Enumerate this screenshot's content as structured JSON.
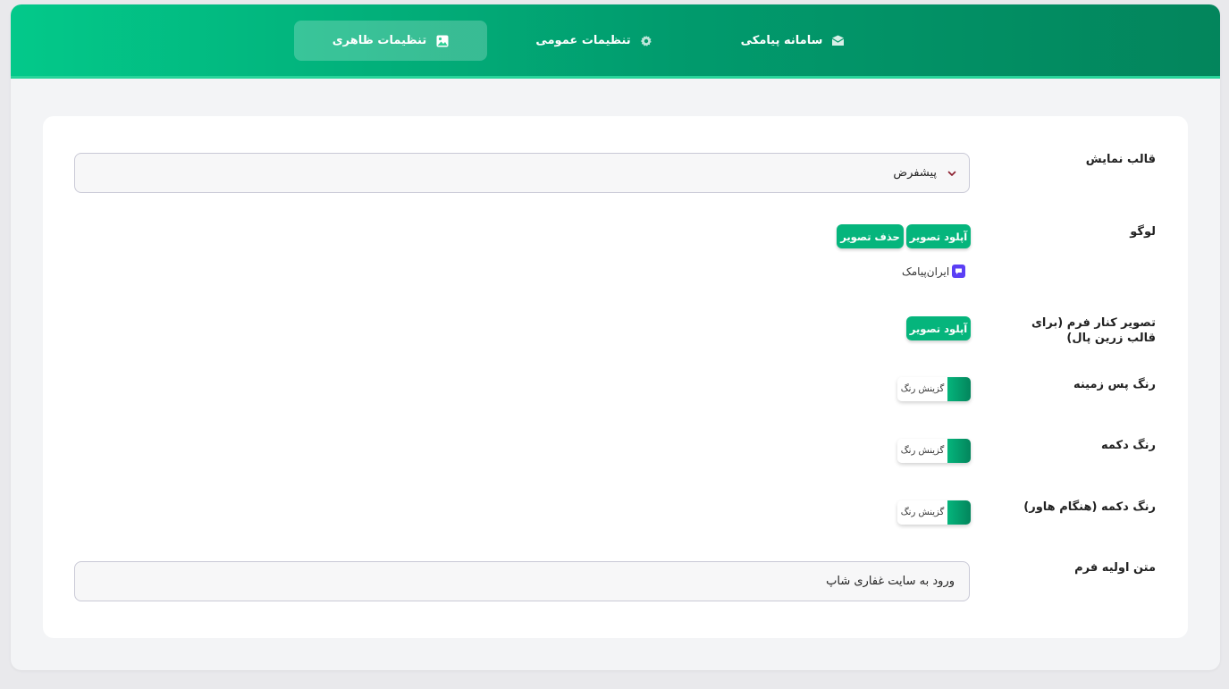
{
  "tabs": [
    {
      "label": "تنظیمات ظاهری",
      "icon": "image-icon",
      "active": true
    },
    {
      "label": "تنظیمات عمومی",
      "icon": "gear-icon",
      "active": false
    },
    {
      "label": "سامانه پیامکی",
      "icon": "envelope-icon",
      "active": false
    }
  ],
  "form": {
    "template": {
      "label": "قالب نمایش",
      "value": "پیشفرض"
    },
    "logo": {
      "label": "لوگو",
      "upload_label": "آپلود تصویر",
      "delete_label": "حذف تصویر",
      "preview_text": "ایران‌پیامک"
    },
    "side_image": {
      "label": "تصویر کنار فرم (برای قالب زرین پال)",
      "upload_label": "آپلود تصویر"
    },
    "bg_color": {
      "label": "رنگ پس زمینه",
      "picker_label": "گزینش رنگ",
      "color": "#04966a"
    },
    "button_color": {
      "label": "رنگ دکمه",
      "picker_label": "گزینش رنگ",
      "color": "#04966a"
    },
    "button_hover_color": {
      "label": "رنگ دکمه (هنگام هاور)",
      "picker_label": "گزینش رنگ",
      "color": "#04966a"
    },
    "initial_text": {
      "label": "متن اولیه فرم",
      "value": "ورود به سایت غفاری شاپ"
    }
  },
  "colors": {
    "brand": "#05b57c",
    "brand_dark": "#03855c",
    "logo_mark": "#5b3ff5"
  }
}
